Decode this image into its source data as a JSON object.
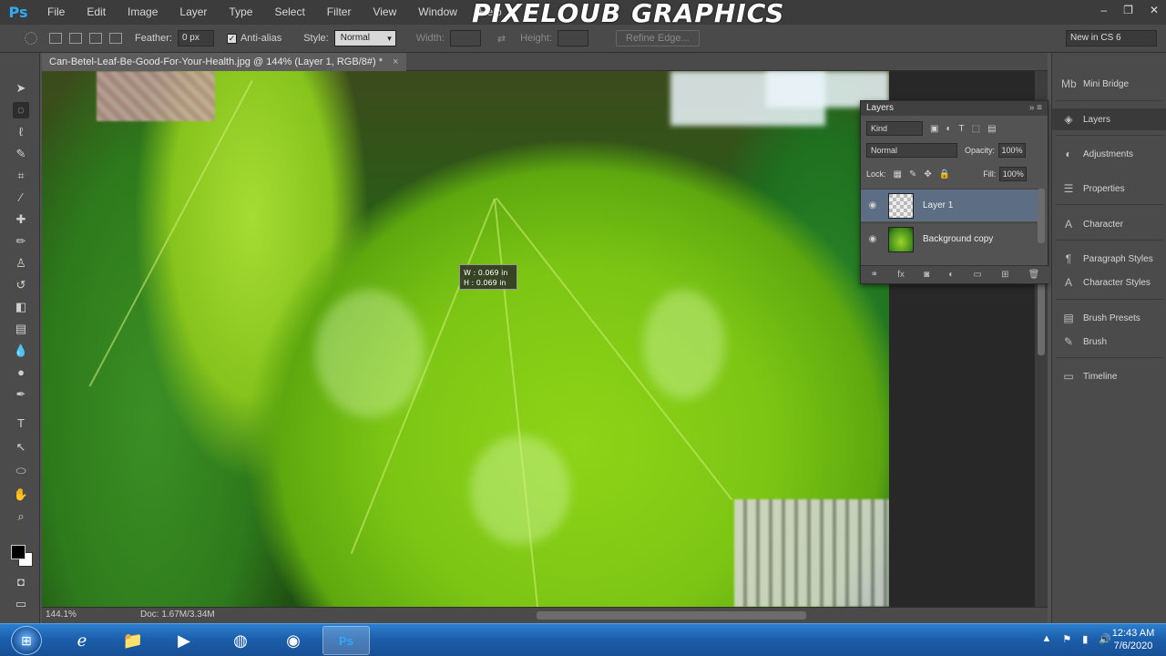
{
  "app": {
    "logo": "Ps",
    "watermark": "PIXELOUB GRAPHICS",
    "window_controls": [
      "–",
      "❐",
      "✕"
    ]
  },
  "menu": [
    "File",
    "Edit",
    "Image",
    "Layer",
    "Type",
    "Select",
    "Filter",
    "View",
    "Window",
    "Help"
  ],
  "options": {
    "feather_label": "Feather:",
    "feather_value": "0 px",
    "antialias_label": "Anti-alias",
    "style_label": "Style:",
    "style_value": "Normal",
    "width_label": "Width:",
    "height_label": "Height:",
    "refine_label": "Refine Edge...",
    "workspace_value": "New in CS 6"
  },
  "document": {
    "tab_title": "Can-Betel-Leaf-Be-Good-For-Your-Health.jpg @ 144% (Layer 1, RGB/8#) *",
    "close": "×",
    "measure_w": "W :  0.069 in",
    "measure_h": "H :  0.069 in"
  },
  "status": {
    "zoom": "144.1%",
    "doc_size": "Doc: 1.67M/3.34M"
  },
  "layers_panel": {
    "title": "Layers",
    "kind_label": "Kind",
    "blend_mode": "Normal",
    "opacity_label": "Opacity:",
    "opacity_value": "100%",
    "lock_label": "Lock:",
    "fill_label": "Fill:",
    "fill_value": "100%",
    "layers": [
      {
        "name": "Layer 1",
        "selected": true
      },
      {
        "name": "Background copy",
        "selected": false
      }
    ]
  },
  "dock": [
    {
      "label": "Mini Bridge",
      "icon": "mini-bridge-icon"
    },
    {
      "label": "Layers",
      "icon": "layers-icon"
    },
    {
      "label": "Adjustments",
      "icon": "adjustments-icon"
    },
    {
      "label": "Properties",
      "icon": "properties-icon"
    },
    {
      "label": "Character",
      "icon": "character-icon"
    },
    {
      "label": "Paragraph Styles",
      "icon": "paragraph-styles-icon"
    },
    {
      "label": "Character Styles",
      "icon": "character-styles-icon"
    },
    {
      "label": "Brush Presets",
      "icon": "brush-presets-icon"
    },
    {
      "label": "Brush",
      "icon": "brush-icon"
    },
    {
      "label": "Timeline",
      "icon": "timeline-icon"
    }
  ],
  "taskbar": {
    "time": "12:43 AM",
    "date": "7/6/2020"
  },
  "colors": {
    "accent": "#30a9f5",
    "selected_layer": "#5d6e84",
    "taskbar": "#1c5fad"
  }
}
